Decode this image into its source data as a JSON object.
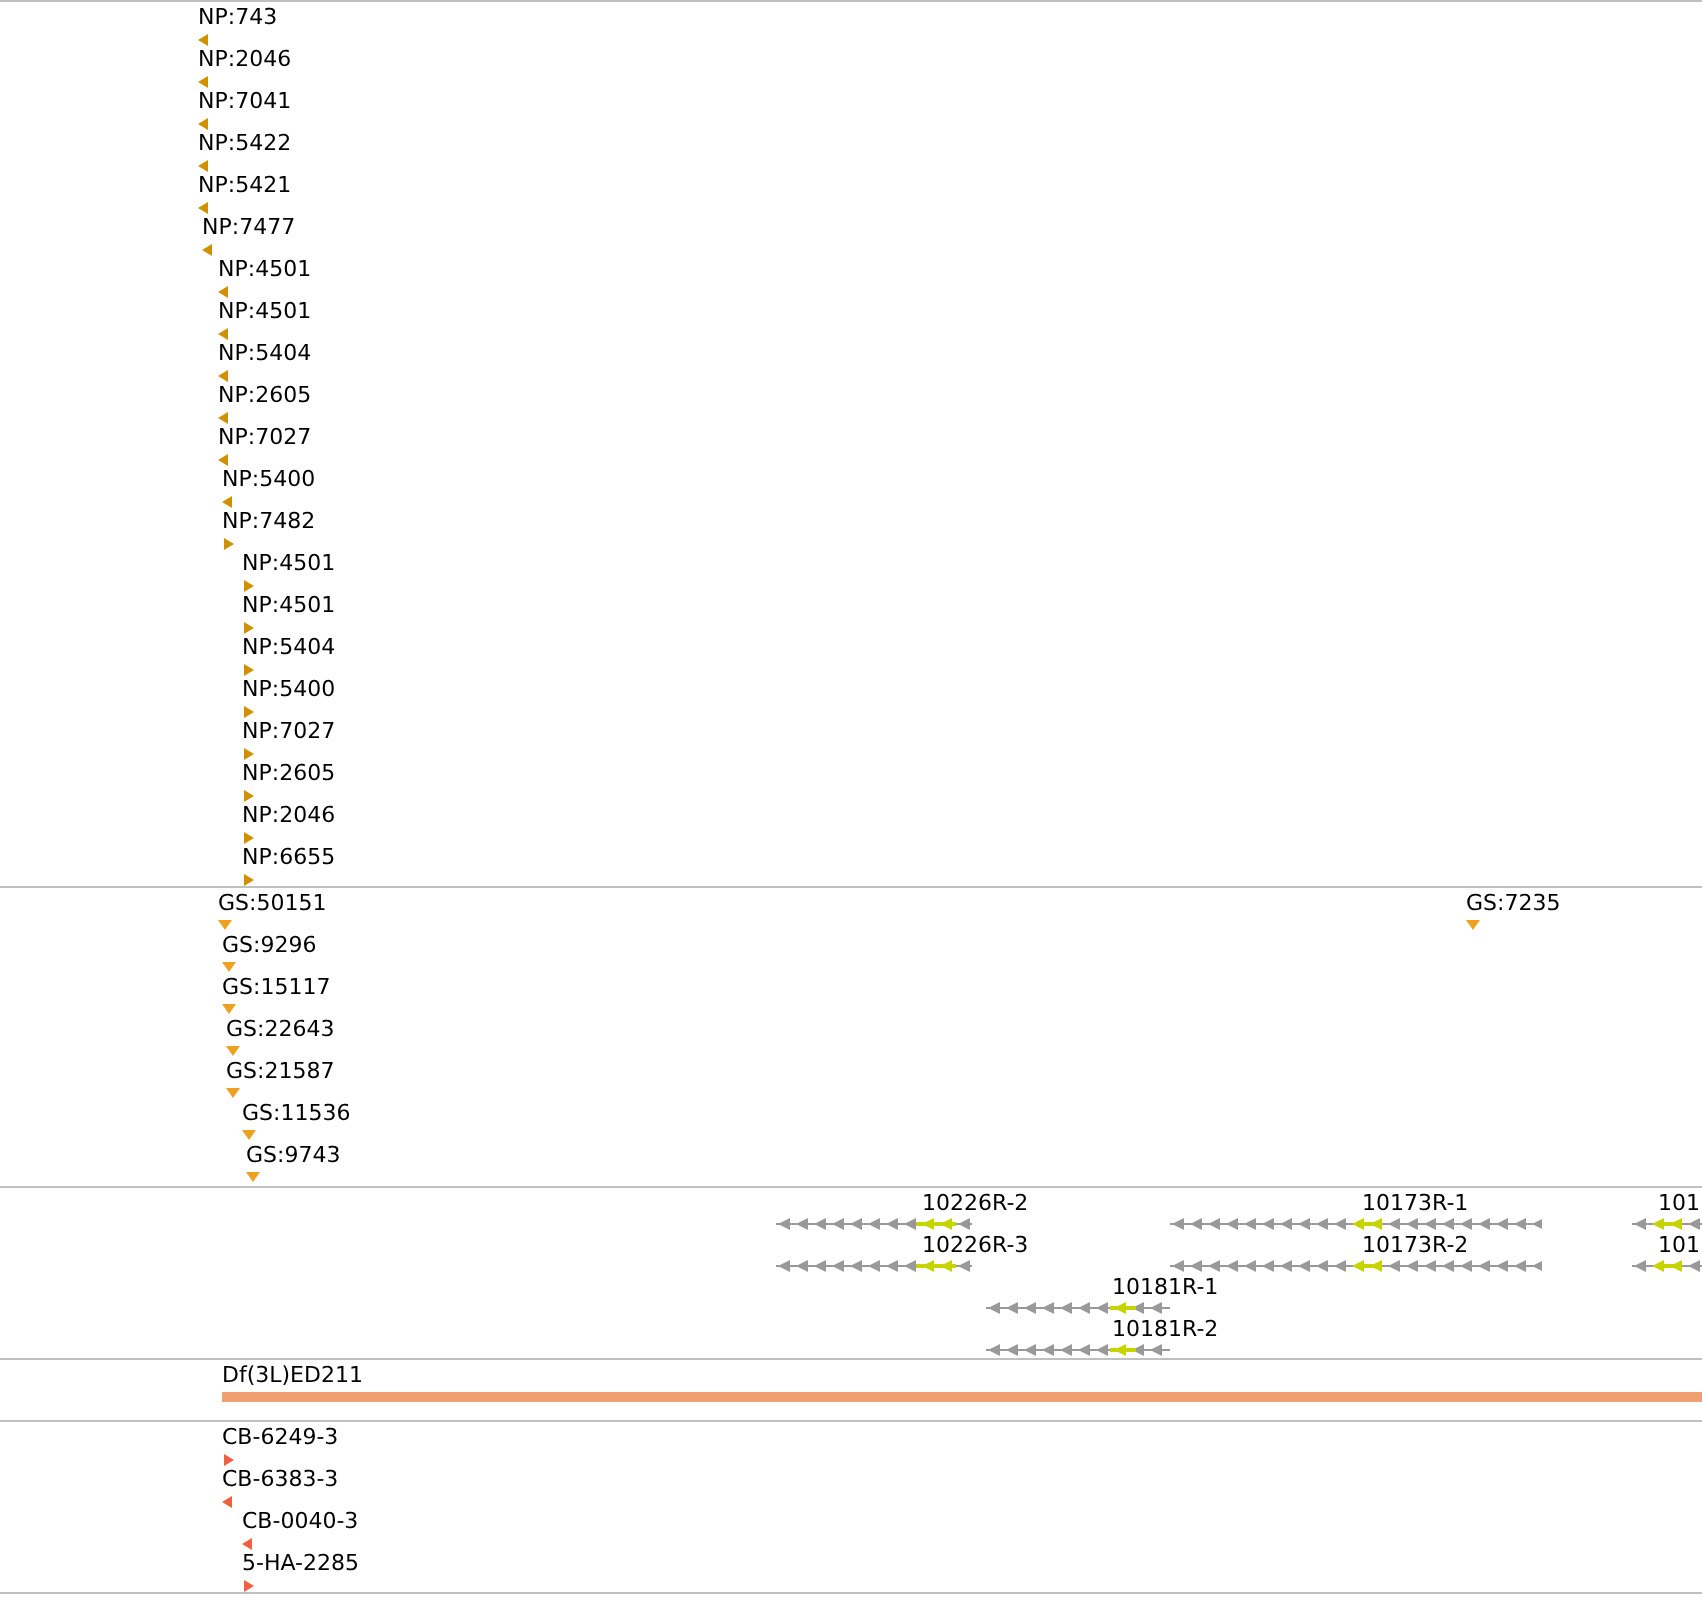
{
  "tracks": [
    {
      "kind": "markers",
      "color": "#d09000",
      "features": [
        {
          "label": "NP:743",
          "kind": "left"
        },
        {
          "label": "NP:2046",
          "kind": "left"
        },
        {
          "label": "NP:7041",
          "kind": "left"
        },
        {
          "label": "NP:5422",
          "kind": "left"
        },
        {
          "label": "NP:5421",
          "kind": "left"
        },
        {
          "label": "NP:7477",
          "kind": "left"
        },
        {
          "label": "NP:4501",
          "kind": "left"
        },
        {
          "label": "NP:4501",
          "kind": "left"
        },
        {
          "label": "NP:5404",
          "kind": "left"
        },
        {
          "label": "NP:2605",
          "kind": "left"
        },
        {
          "label": "NP:7027",
          "kind": "left"
        },
        {
          "label": "NP:5400",
          "kind": "left"
        },
        {
          "label": "NP:7482",
          "kind": "right"
        },
        {
          "label": "NP:4501",
          "kind": "right"
        },
        {
          "label": "NP:4501",
          "kind": "right"
        },
        {
          "label": "NP:5404",
          "kind": "right"
        },
        {
          "label": "NP:5400",
          "kind": "right"
        },
        {
          "label": "NP:7027",
          "kind": "right"
        },
        {
          "label": "NP:2605",
          "kind": "right"
        },
        {
          "label": "NP:2046",
          "kind": "right"
        },
        {
          "label": "NP:6655",
          "kind": "right"
        }
      ]
    },
    {
      "kind": "markers",
      "color": "#f0a020",
      "features": [
        {
          "label": "GS:50151",
          "kind": "point"
        },
        {
          "label": "GS:7235",
          "kind": "point"
        },
        {
          "label": "GS:9296",
          "kind": "point"
        },
        {
          "label": "GS:15117",
          "kind": "point"
        },
        {
          "label": "GS:22643",
          "kind": "point"
        },
        {
          "label": "GS:21587",
          "kind": "point"
        },
        {
          "label": "GS:11536",
          "kind": "point"
        },
        {
          "label": "GS:9743",
          "kind": "point"
        }
      ]
    },
    {
      "kind": "genes",
      "features": [
        {
          "label": "10226R-2"
        },
        {
          "label": "10173R-1"
        },
        {
          "label": "101"
        },
        {
          "label": "10226R-3"
        },
        {
          "label": "10173R-2"
        },
        {
          "label": "101"
        },
        {
          "label": "10181R-1"
        },
        {
          "label": "10181R-2"
        }
      ]
    },
    {
      "kind": "bar",
      "color": "#f0a070",
      "features": [
        {
          "label": "Df(3L)ED211"
        }
      ]
    },
    {
      "kind": "markers",
      "color": "#f06040",
      "features": [
        {
          "label": "CB-6249-3",
          "kind": "right"
        },
        {
          "label": "CB-6383-3",
          "kind": "left"
        },
        {
          "label": "CB-0040-3",
          "kind": "left"
        },
        {
          "label": "5-HA-2285",
          "kind": "right"
        }
      ]
    }
  ]
}
